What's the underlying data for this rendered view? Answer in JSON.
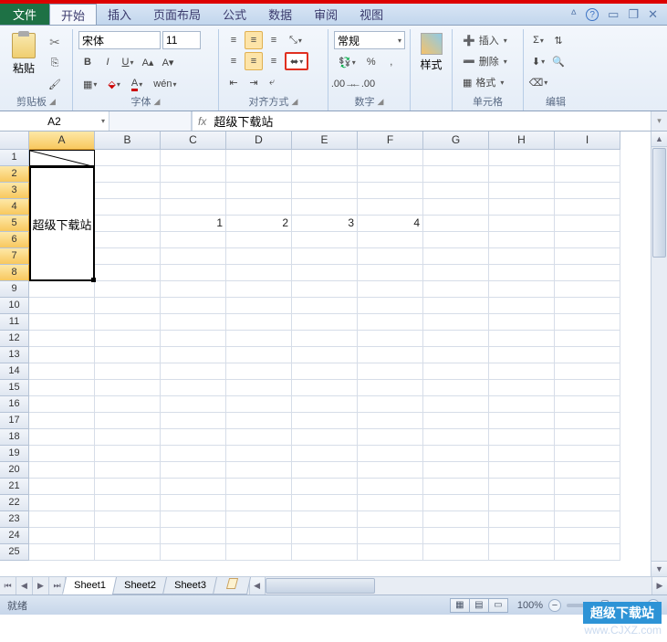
{
  "tabs": {
    "file": "文件",
    "home": "开始",
    "insert": "插入",
    "layout": "页面布局",
    "formula": "公式",
    "data": "数据",
    "review": "审阅",
    "view": "视图"
  },
  "ribbon": {
    "clipboard": {
      "label": "剪贴板",
      "paste": "粘贴"
    },
    "font": {
      "label": "字体",
      "name": "宋体",
      "size": "11"
    },
    "align": {
      "label": "对齐方式"
    },
    "number": {
      "label": "数字",
      "format": "常规"
    },
    "style": {
      "label": "样式"
    },
    "cells": {
      "label": "单元格",
      "insert": "插入",
      "delete": "删除",
      "format": "格式"
    },
    "edit": {
      "label": "编辑"
    }
  },
  "namebox": "A2",
  "formula": "超级下载站",
  "columns": [
    "A",
    "B",
    "C",
    "D",
    "E",
    "F",
    "G",
    "H",
    "I"
  ],
  "rowcount": 25,
  "merged_text": "超级下载站",
  "row5": {
    "C": "1",
    "D": "2",
    "E": "3",
    "F": "4"
  },
  "sheets": [
    "Sheet1",
    "Sheet2",
    "Sheet3"
  ],
  "status": "就绪",
  "zoom": "100%",
  "watermark": {
    "l1": "超级下载站",
    "l2": "www.CJXZ.com"
  }
}
